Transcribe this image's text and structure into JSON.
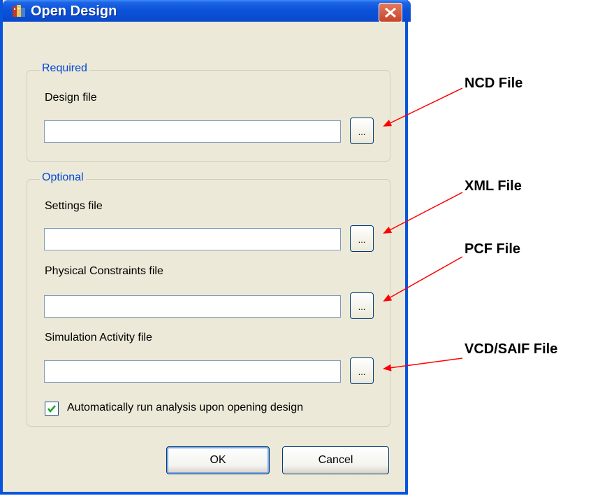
{
  "window": {
    "title": "Open Design",
    "close_glyph": "×"
  },
  "required_group": {
    "label": "Required",
    "design_file_label": "Design file",
    "design_file_value": "",
    "browse_label": "..."
  },
  "optional_group": {
    "label": "Optional",
    "settings_file_label": "Settings file",
    "settings_file_value": "",
    "physical_constraints_label": "Physical Constraints file",
    "physical_constraints_value": "",
    "simulation_activity_label": "Simulation Activity file",
    "simulation_activity_value": "",
    "browse_label": "...",
    "auto_run_label": "Automatically run analysis upon opening design",
    "auto_run_checked": true
  },
  "buttons": {
    "ok_label": "OK",
    "cancel_label": "Cancel"
  },
  "annotations": {
    "ncd": "NCD File",
    "xml": "XML File",
    "pcf": "PCF File",
    "vcd": "VCD/SAIF File"
  },
  "colors": {
    "titlebar": "#0a53d8",
    "group_label": "#0046d5",
    "arrow": "#ff0000",
    "dialog_bg": "#ece9d8"
  }
}
